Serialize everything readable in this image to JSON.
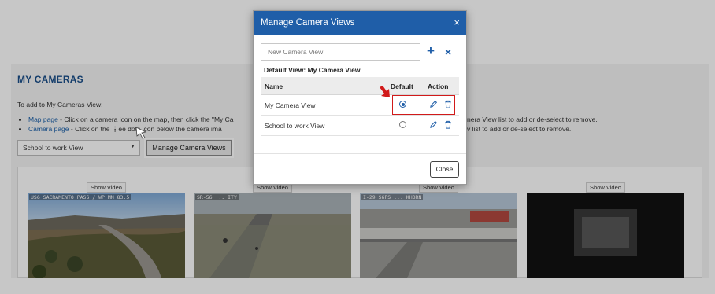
{
  "page": {
    "title": "MY CAMERAS",
    "intro": "To add to My Cameras View:",
    "bullets": [
      {
        "link": "Map page",
        "text": " - Click on a camera icon on the map, then click the \"My Ca",
        "rest": "nera View list to add or de-select to remove."
      },
      {
        "link": "Camera page",
        "text": " - Click on the ",
        "kebab": "⋮",
        "text2": "ee dots icon below the camera ima",
        "rest": "v list to add or de-select to remove."
      }
    ],
    "view_select": "School to work View",
    "manage_button": "Manage Camera Views",
    "show_video": "Show Video",
    "cameras": [
      {
        "caption": "US6 SACRAMENTO PASS / WP MM 83.5"
      },
      {
        "caption": "SR-56 ... ITY"
      },
      {
        "caption": "I-29 S6PS ... KHORN"
      },
      {
        "caption": ""
      }
    ]
  },
  "modal": {
    "title": "Manage Camera Views",
    "close_x": "×",
    "input_placeholder": "New Camera View",
    "add_icon": "+",
    "clear_icon": "×",
    "default_view": "Default View: My Camera View",
    "col_name": "Name",
    "col_default": "Default",
    "col_action": "Action",
    "rows": [
      {
        "name": "My Camera View",
        "default": true
      },
      {
        "name": "School to work View",
        "default": false
      }
    ],
    "close_button": "Close"
  },
  "colors": {
    "header_blue": "#1f5ea8",
    "highlight_red": "#d11a1a"
  }
}
